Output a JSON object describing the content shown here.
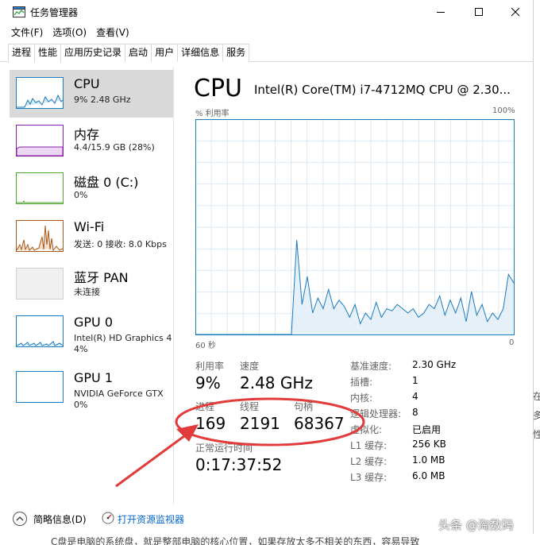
{
  "window": {
    "title": "任务管理器"
  },
  "menu": [
    "文件(F)",
    "选项(O)",
    "查看(V)"
  ],
  "tabs": [
    "进程",
    "性能",
    "应用历史记录",
    "启动",
    "用户",
    "详细信息",
    "服务"
  ],
  "active_tab": "性能",
  "sidebar": [
    {
      "title": "CPU",
      "sub": "9%  2.48 GHz",
      "color": "#1a7bbf",
      "selected": true
    },
    {
      "title": "内存",
      "sub": "4.4/15.9 GB (28%)",
      "color": "#8b1fa9"
    },
    {
      "title": "磁盘 0 (C:)",
      "sub": "0%",
      "color": "#4ea72e"
    },
    {
      "title": "Wi-Fi",
      "sub": "发送: 0 接收: 8.0 Kbps",
      "color": "#a7581a"
    },
    {
      "title": "蓝牙 PAN",
      "sub": "未连接",
      "color": "#bdbdbd"
    },
    {
      "title": "GPU 0",
      "sub": "Intel(R) HD Graphics 4",
      "sub2": "4%",
      "color": "#1a7bbf"
    },
    {
      "title": "GPU 1",
      "sub": "NVIDIA GeForce GTX",
      "sub2": "0%",
      "color": "#1a7bbf"
    }
  ],
  "main": {
    "title": "CPU",
    "model": "Intel(R) Core(TM) i7-4712MQ CPU @ 2.30...",
    "y_label": "% 利用率",
    "y_max_label": "100%",
    "x_left_label": "60 秒",
    "x_right_label": "0"
  },
  "stats": {
    "util_label": "利用率",
    "util_value": "9%",
    "speed_label": "速度",
    "speed_value": "2.48 GHz",
    "proc_label": "进程",
    "proc_value": "169",
    "thread_label": "线程",
    "thread_value": "2191",
    "handle_label": "句柄",
    "handle_value": "68367",
    "uptime_label": "正常运行时间",
    "uptime_value": "0:17:37:52"
  },
  "specs": [
    {
      "key": "基准速度:",
      "value": "2.30 GHz"
    },
    {
      "key": "插槽:",
      "value": "1"
    },
    {
      "key": "内核:",
      "value": "4"
    },
    {
      "key": "逻辑处理器:",
      "value": "8"
    },
    {
      "key": "虚拟化:",
      "value": "已启用"
    },
    {
      "key": "L1 缓存:",
      "value": "256 KB"
    },
    {
      "key": "L2 缓存:",
      "value": "1.0 MB"
    },
    {
      "key": "L3 缓存:",
      "value": "6.0 MB"
    }
  ],
  "footer": {
    "fewer_details": "简略信息(D)",
    "open_monitor": "打开资源监视器"
  },
  "background": {
    "side_chars": [
      "在",
      "多",
      "性"
    ],
    "bottom_text": "C盘是电脑的系统盘，就是整部电脑的核心位置，如果存放太多不相关的东西，容易导致",
    "watermark": "头条 @淘数码"
  },
  "chart_data": {
    "type": "area",
    "title": "CPU",
    "ylabel": "% 利用率",
    "ylim": [
      0,
      100
    ],
    "xlim": [
      60,
      0
    ],
    "x": [
      60,
      59,
      58,
      57,
      56,
      55,
      54,
      53,
      52,
      51,
      50,
      49,
      48,
      47,
      46,
      45,
      44,
      43,
      42,
      41,
      40,
      39,
      38,
      37,
      36,
      35,
      34,
      33,
      32,
      31,
      30,
      29,
      28,
      27,
      26,
      25,
      24,
      23,
      22,
      21,
      20,
      19,
      18,
      17,
      16,
      15,
      14,
      13,
      12,
      11,
      10,
      9,
      8,
      7,
      6,
      5,
      4,
      3,
      2,
      1,
      0
    ],
    "series": [
      {
        "values": [
          0,
          0,
          0,
          0,
          0,
          0,
          0,
          0,
          0,
          0,
          0,
          0,
          0,
          0,
          0,
          0,
          0,
          0,
          0,
          44,
          14,
          27,
          10,
          17,
          12,
          21,
          12,
          16,
          13,
          8,
          14,
          5,
          10,
          7,
          15,
          8,
          12,
          11,
          14,
          12,
          10,
          12,
          8,
          10,
          14,
          12,
          18,
          9,
          16,
          10,
          17,
          6,
          20,
          9,
          14,
          6,
          10,
          7,
          12,
          28,
          24
        ]
      }
    ]
  }
}
